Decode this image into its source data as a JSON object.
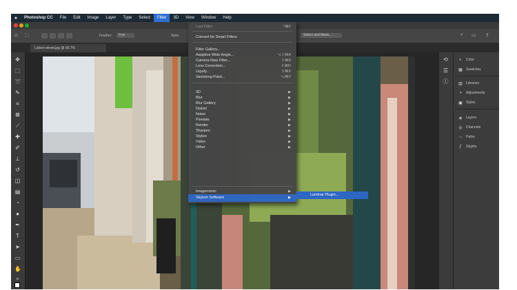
{
  "menubar": {
    "app": "Photoshop CC",
    "items": [
      "File",
      "Edit",
      "Image",
      "Layer",
      "Type",
      "Select",
      "Filter",
      "3D",
      "View",
      "Window",
      "Help"
    ],
    "active_index": 6
  },
  "options": {
    "feather": "Feather:",
    "feather_value": "0 px",
    "style": "Style:",
    "select_and_mask": "Select and Mask..."
  },
  "document_tab": "Lisbon-street.jpg @ 66.7%",
  "filter_menu": {
    "items": [
      {
        "label": "Last Filter",
        "shortcut": "^⌘F",
        "type": "dim"
      },
      {
        "label": "Convert for Smart Filters",
        "shortcut": ""
      },
      {
        "label": "Filter Gallery...",
        "shortcut": ""
      },
      {
        "label": "Adaptive Wide Angle...",
        "shortcut": "⌥⇧⌘A"
      },
      {
        "label": "Camera Raw Filter...",
        "shortcut": "⇧⌘A"
      },
      {
        "label": "Lens Correction...",
        "shortcut": "⇧⌘R"
      },
      {
        "label": "Liquify...",
        "shortcut": "⇧⌘X"
      },
      {
        "label": "Vanishing Point...",
        "shortcut": "⌥⌘V"
      },
      {
        "label": "3D",
        "submenu": true
      },
      {
        "label": "Blur",
        "submenu": true
      },
      {
        "label": "Blur Gallery",
        "submenu": true
      },
      {
        "label": "Distort",
        "submenu": true
      },
      {
        "label": "Noise",
        "submenu": true
      },
      {
        "label": "Pixelate",
        "submenu": true
      },
      {
        "label": "Render",
        "submenu": true
      },
      {
        "label": "Sharpen",
        "submenu": true
      },
      {
        "label": "Stylize",
        "submenu": true
      },
      {
        "label": "Video",
        "submenu": true
      },
      {
        "label": "Other",
        "submenu": true
      },
      {
        "label": "Imagenomic",
        "submenu": true
      },
      {
        "label": "Skylum Software",
        "submenu": true,
        "type": "selected"
      }
    ],
    "submenu_item": "Luminar Plugin..."
  },
  "right_panel": {
    "items": [
      "Color",
      "Swatches",
      "Libraries",
      "Adjustments",
      "Styles",
      "Layers",
      "Channels",
      "Paths",
      "Glyphs"
    ]
  },
  "colors": {
    "menubar_bg": "#1c2a35",
    "selection_blue": "#2e66c4",
    "panel_bg": "#3c3c3c"
  }
}
